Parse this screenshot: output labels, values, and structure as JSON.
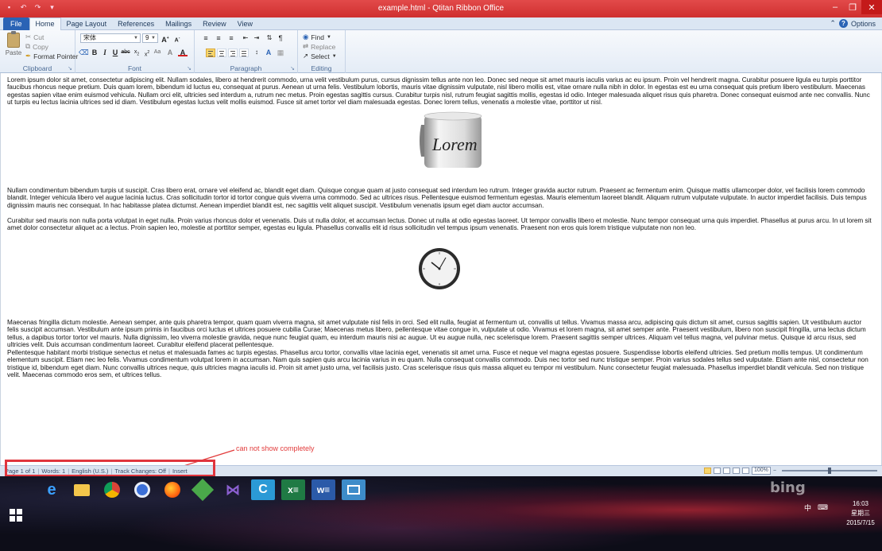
{
  "window": {
    "title": "example.html - Qtitan Ribbon Office",
    "qat": [
      "▪",
      "↶",
      "↷",
      "▾"
    ]
  },
  "menu": {
    "tabs": [
      "File",
      "Home",
      "Page Layout",
      "References",
      "Mailings",
      "Review",
      "View"
    ],
    "active_tab": "Home",
    "options_label": "Options"
  },
  "ribbon": {
    "clipboard": {
      "label": "Clipboard",
      "paste": "Paste",
      "cut": "Cut",
      "copy": "Copy",
      "format_painter": "Format Pointer"
    },
    "font": {
      "label": "Font",
      "font_name": "宋体",
      "font_size": "9"
    },
    "paragraph": {
      "label": "Paragraph"
    },
    "editing": {
      "label": "Editing",
      "find": "Find",
      "replace": "Replace",
      "select": "Select"
    }
  },
  "document": {
    "paragraphs": [
      "Lorem ipsum dolor sit amet, consectetur adipiscing elit. Nullam sodales, libero at hendrerit commodo, urna velit vestibulum purus, cursus dignissim tellus ante non leo. Donec sed neque sit amet mauris iaculis varius ac eu ipsum. Proin vel hendrerit magna. Curabitur posuere ligula eu turpis porttitor faucibus rhoncus neque pretium. Duis quam lorem, bibendum id luctus eu, consequat at purus. Aenean ut urna felis. Vestibulum lobortis, mauris vitae dignissim vulputate, nisl libero mollis est, vitae ornare nulla nibh in dolor. In egestas est eu urna consequat quis pretium libero vestibulum. Maecenas egestas sapien vitae enim euismod vehicula. Nullam orci elit, ultricies sed interdum a, rutrum nec metus. Proin egestas sagittis cursus. Curabitur turpis nisl, rutrum feugiat sagittis mollis, egestas id odio. Integer malesuada aliquet risus quis pharetra. Donec consequat euismod ante nec convallis. Nunc ut turpis eu lectus lacinia ultrices sed id diam. Vestibulum egestas luctus velit mollis euismod. Fusce sit amet tortor vel diam malesuada egestas. Donec lorem tellus, venenatis a molestie vitae, porttitor ut nisl.",
      "Nullam condimentum bibendum turpis ut suscipit. Cras libero erat, ornare vel eleifend ac, blandit eget diam. Quisque congue quam at justo consequat sed interdum leo rutrum. Integer gravida auctor rutrum. Praesent ac fermentum enim. Quisque mattis ullamcorper dolor, vel facilisis lorem commodo blandit. Integer vehicula libero vel augue lacinia luctus. Cras sollicitudin tortor id tortor congue quis viverra urna commodo. Sed ac ultrices risus. Pellentesque euismod fermentum egestas. Mauris elementum laoreet blandit. Aliquam rutrum vulputate vulputate. In auctor imperdiet facilisis. Duis tempus dignissim mauris nec consequat. In hac habitasse platea dictumst. Aenean imperdiet blandit est, nec sagittis velit aliquet suscipit. Vestibulum venenatis ipsum eget diam auctor accumsan.",
      "Curabitur sed mauris non nulla porta volutpat in eget nulla. Proin varius rhoncus dolor et venenatis. Duis ut nulla dolor, et accumsan lectus. Donec ut nulla at odio egestas laoreet. Ut tempor convallis libero et molestie. Nunc tempor consequat urna quis imperdiet. Phasellus at purus arcu. In ut lorem sit amet dolor consectetur aliquet ac a lectus. Proin sapien leo, molestie at porttitor semper, egestas eu ligula. Phasellus convallis elit id risus sollicitudin vel tempus ipsum venenatis. Praesent non eros quis lorem tristique vulputate non non leo.",
      "Maecenas fringilla dictum molestie. Aenean semper, ante quis pharetra tempor, quam quam viverra magna, sit amet vulputate nisl felis in orci. Sed elit nulla, feugiat at fermentum ut, convallis ut tellus. Vivamus massa arcu, adipiscing quis dictum sit amet, cursus sagittis sapien. Ut vestibulum auctor felis suscipit accumsan. Vestibulum ante ipsum primis in faucibus orci luctus et ultrices posuere cubilia Curae; Maecenas metus libero, pellentesque vitae congue in, vulputate ut odio. Vivamus et lorem magna, sit amet semper ante. Praesent vestibulum, libero non suscipit fringilla, urna lectus dictum tellus, a dapibus tortor tortor vel mauris. Nulla dignissim, leo viverra molestie gravida, neque nunc feugiat quam, eu interdum mauris nisi ac augue. Ut eu augue nulla, nec scelerisque lorem. Praesent sagittis semper ultrices. Aliquam vel tellus magna, vel pulvinar metus. Quisque id arcu risus, sed ultricies velit. Duis accumsan condimentum laoreet. Curabitur eleifend placerat pellentesque.",
      "Pellentesque habitant morbi tristique senectus et netus et malesuada fames ac turpis egestas. Phasellus arcu tortor, convallis vitae lacinia eget, venenatis sit amet urna. Fusce et neque vel magna egestas posuere. Suspendisse lobortis eleifend ultricies. Sed pretium mollis tempus. Ut condimentum elementum suscipit. Etiam nec leo felis. Vivamus condimentum volutpat lorem in accumsan. Nam quis sapien quis arcu lacinia varius in eu quam. Nulla consequat convallis commodo. Duis nec tortor sed nunc tristique semper. Proin varius sodales tellus sed vulputate. Etiam ante nisl, consectetur non tristique id, bibendum eget diam. Nunc convallis ultrices neque, quis ultricies magna iaculis id. Proin sit amet justo urna, vel facilisis justo. Cras scelerisque risus quis massa aliquet eu tempor mi vestibulum. Nunc consectetur feugiat malesuada. Phasellus imperdiet blandit vehicula. Sed non tristique velit. Maecenas commodo eros sem, et ultrices tellus."
    ],
    "mug_text": "Lorem"
  },
  "annotation": {
    "text": "can not show completely",
    "color": "#e23b3b"
  },
  "statusbar": {
    "page": "Page 1 of 1",
    "words": "Words: 1",
    "language": "English (U.S.)",
    "track_changes": "Track Changes: Off",
    "mode": "Insert",
    "zoom": "100%"
  },
  "taskbar": {
    "bing": "bing",
    "tray_lang": "中",
    "time": "16:03",
    "weekday": "星期三",
    "date": "2015/7/15"
  },
  "colors": {
    "titlebar": "#d63a3a",
    "file_tab": "#2a63b5",
    "highlight": "#e0353d"
  }
}
